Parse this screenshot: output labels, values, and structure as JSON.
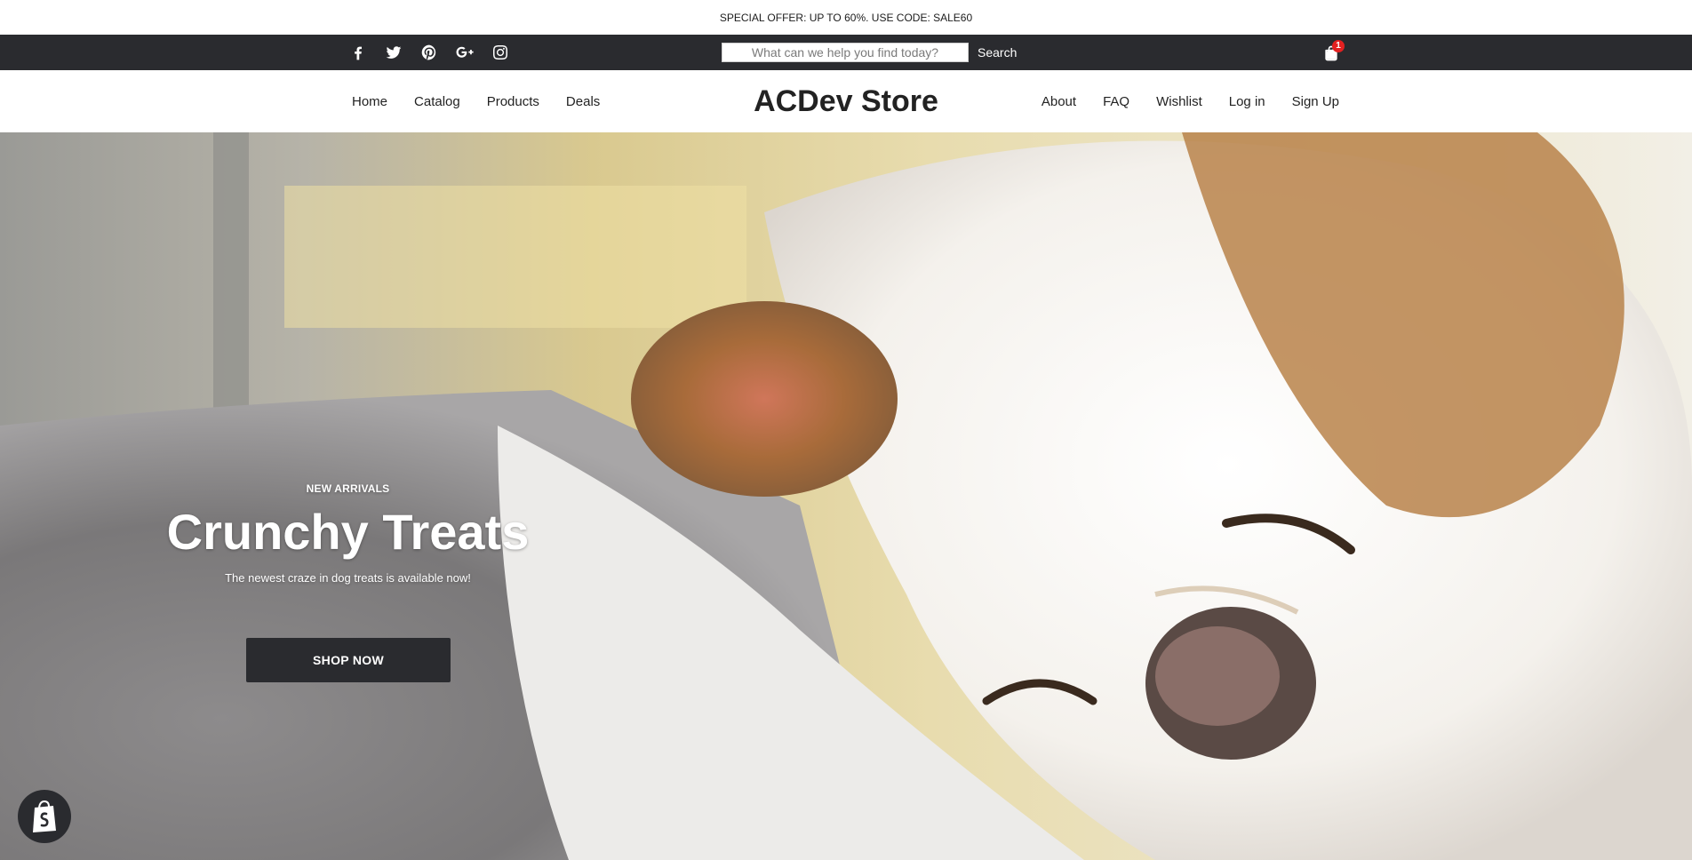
{
  "announcement": {
    "text": "SPECIAL OFFER: UP TO 60%. USE CODE: SALE60"
  },
  "utility_bar": {
    "social_icons": [
      "facebook-icon",
      "twitter-icon",
      "pinterest-icon",
      "google-plus-icon",
      "instagram-icon"
    ],
    "search": {
      "placeholder": "What can we help you find today?",
      "value": "",
      "button_label": "Search"
    },
    "cart": {
      "icon": "shopping-bag-icon",
      "count": "1"
    },
    "colors": {
      "background": "#2a2b2f",
      "badge": "#e32121"
    }
  },
  "nav": {
    "left": [
      {
        "label": "Home"
      },
      {
        "label": "Catalog"
      },
      {
        "label": "Products"
      },
      {
        "label": "Deals"
      }
    ],
    "logo": "ACDev Store",
    "right": [
      {
        "label": "About"
      },
      {
        "label": "FAQ"
      },
      {
        "label": "Wishlist"
      },
      {
        "label": "Log in"
      },
      {
        "label": "Sign Up"
      }
    ]
  },
  "hero": {
    "eyebrow": "NEW ARRIVALS",
    "title": "Crunchy Treats",
    "subtitle": "The newest craze in dog treats is available now!",
    "button_label": "SHOP NOW",
    "image": "sleeping dog on blanket"
  },
  "shopify_badge": {
    "icon": "shopify-bag-icon"
  }
}
